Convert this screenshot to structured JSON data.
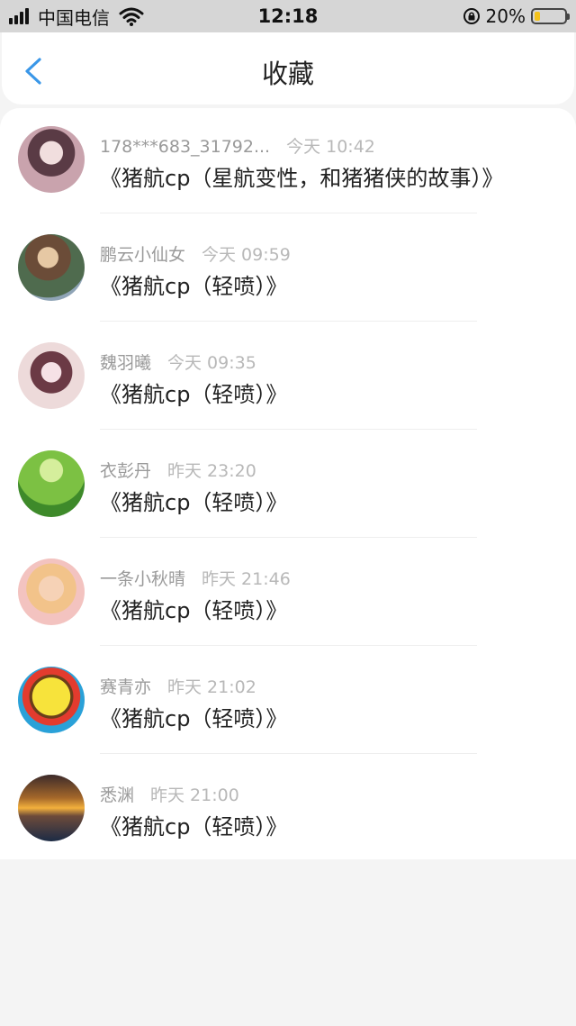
{
  "status_bar": {
    "carrier": "中国电信",
    "time": "12:18",
    "battery": "20%",
    "battery_level": 0.2,
    "icons": [
      "signal-icon",
      "wifi-icon",
      "rotation-lock-icon",
      "battery-icon"
    ]
  },
  "header": {
    "title": "收藏",
    "back_icon": "chevron-left-icon"
  },
  "colors": {
    "accent": "#3a97e8",
    "title_text": "#222222",
    "meta_text": "#9a9a9a",
    "battery": "#f4c21b"
  },
  "favorites": [
    {
      "user": "178***683_31792...",
      "time": "今天 10:42",
      "title": "《猪航cp（星航变性，和猪猪侠的故事）》"
    },
    {
      "user": "鹏云小仙女",
      "time": "今天 09:59",
      "title": "《猪航cp（轻喷）》"
    },
    {
      "user": "魏羽曦",
      "time": "今天 09:35",
      "title": "《猪航cp（轻喷）》"
    },
    {
      "user": "衣彭丹",
      "time": "昨天 23:20",
      "title": "《猪航cp（轻喷）》"
    },
    {
      "user": "一条小秋晴",
      "time": "昨天 21:46",
      "title": "《猪航cp（轻喷）》"
    },
    {
      "user": "赛青亦",
      "time": "昨天 21:02",
      "title": "《猪航cp（轻喷）》"
    },
    {
      "user": "悉渊",
      "time": "昨天 21:00",
      "title": "《猪航cp（轻喷）》"
    }
  ]
}
